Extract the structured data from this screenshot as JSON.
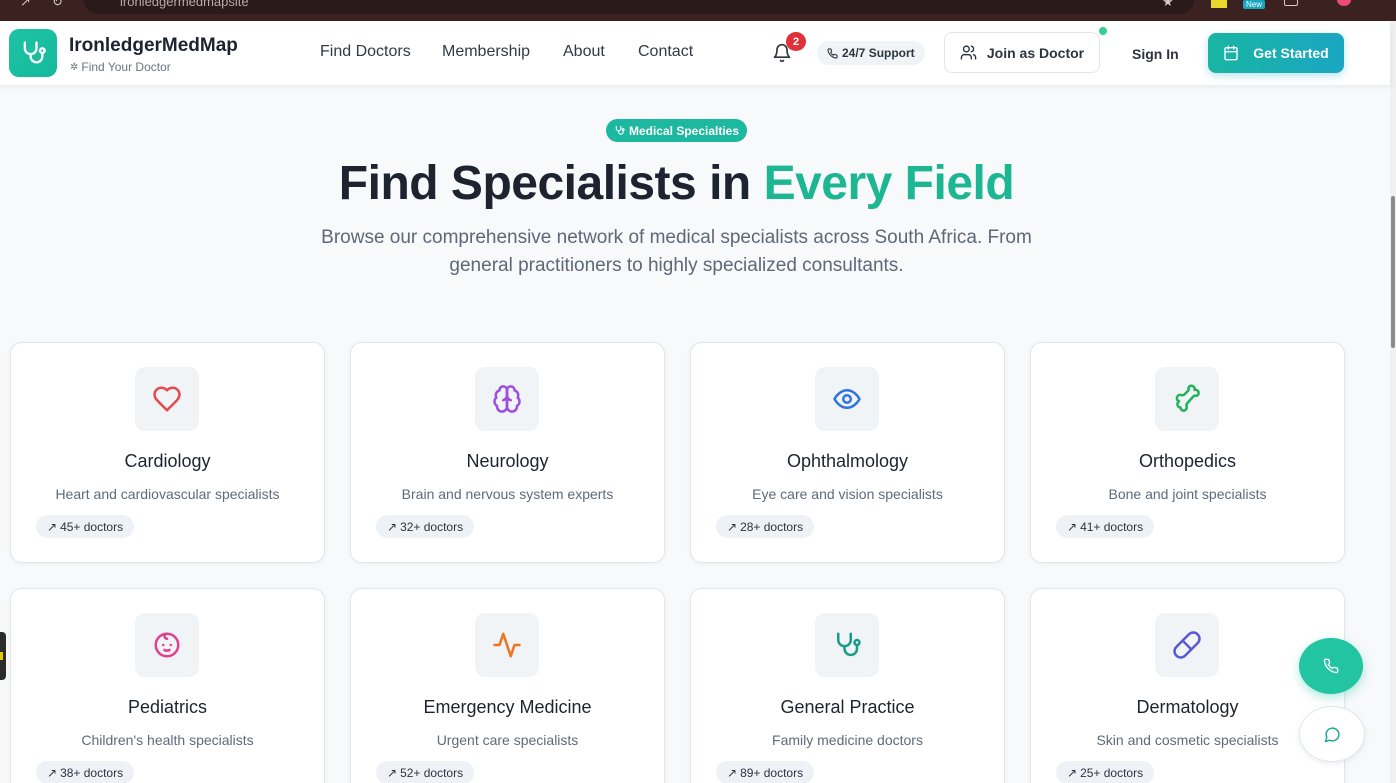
{
  "browser": {
    "url": "ironledgermedmapsite",
    "extension_badge": "New"
  },
  "header": {
    "brand": "IronledgerMedMap",
    "tagline": "Find Your Doctor",
    "nav": [
      "Find Doctors",
      "Membership",
      "About",
      "Contact"
    ],
    "notification_count": "2",
    "support_label": "24/7 Support",
    "join_label": "Join as Doctor",
    "signin_label": "Sign In",
    "get_started_label": "Get Started"
  },
  "hero": {
    "pill": "Medical Specialties",
    "title_main": "Find Specialists in ",
    "title_accent": "Every Field",
    "subtitle": "Browse our comprehensive network of medical specialists across South Africa. From general practitioners to highly specialized consultants."
  },
  "specialties": [
    {
      "name": "Cardiology",
      "desc": "Heart and cardiovascular specialists",
      "count": "45+ doctors",
      "icon": "heart-icon",
      "color": "#e5484d"
    },
    {
      "name": "Neurology",
      "desc": "Brain and nervous system experts",
      "count": "32+ doctors",
      "icon": "brain-icon",
      "color": "#9d4fe0"
    },
    {
      "name": "Ophthalmology",
      "desc": "Eye care and vision specialists",
      "count": "28+ doctors",
      "icon": "eye-icon",
      "color": "#2f73e0"
    },
    {
      "name": "Orthopedics",
      "desc": "Bone and joint specialists",
      "count": "41+ doctors",
      "icon": "bone-icon",
      "color": "#22b35a"
    },
    {
      "name": "Pediatrics",
      "desc": "Children's health specialists",
      "count": "38+ doctors",
      "icon": "baby-icon",
      "color": "#e0418f"
    },
    {
      "name": "Emergency Medicine",
      "desc": "Urgent care specialists",
      "count": "52+ doctors",
      "icon": "activity-icon",
      "color": "#f07420"
    },
    {
      "name": "General Practice",
      "desc": "Family medicine doctors",
      "count": "89+ doctors",
      "icon": "stethoscope-icon",
      "color": "#179c8a"
    },
    {
      "name": "Dermatology",
      "desc": "Skin and cosmetic specialists",
      "count": "25+ doctors",
      "icon": "pill-icon",
      "color": "#5b57d9"
    }
  ],
  "colors": {
    "brand_teal": "#1cb89f",
    "accent_green": "#1db692",
    "cta_gradient_end": "#1aa6c2"
  }
}
